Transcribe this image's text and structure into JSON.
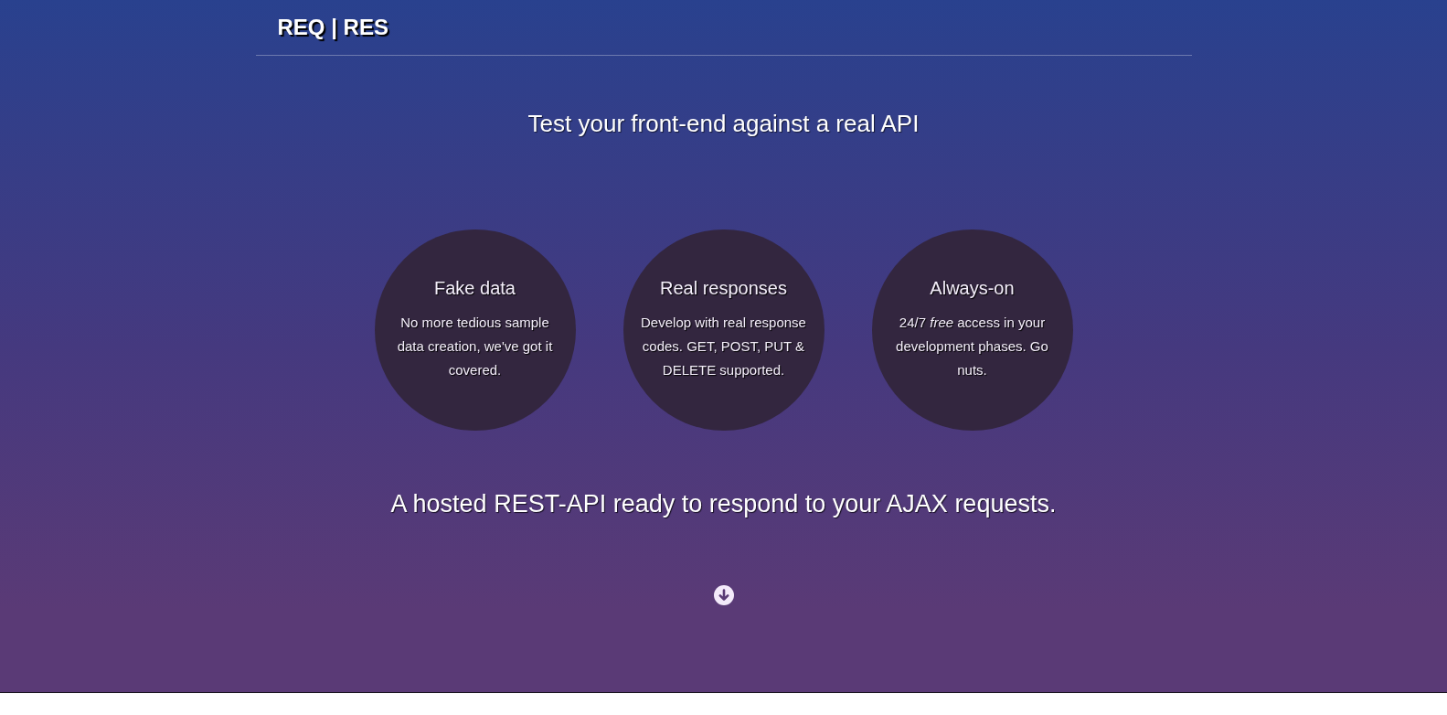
{
  "header": {
    "logo": "REQ | RES"
  },
  "hero": {
    "tagline": "Test your front-end against a real API",
    "features": [
      {
        "title": "Fake data",
        "text": "No more tedious sample data creation, we've got it covered."
      },
      {
        "title": "Real responses",
        "text": "Develop with real response codes. GET, POST, PUT & DELETE supported."
      },
      {
        "title": "Always-on",
        "text": "24/7 *free* access in your development phases. Go nuts."
      }
    ],
    "subtitle": "A hosted REST-API ready to respond to your AJAX requests."
  }
}
